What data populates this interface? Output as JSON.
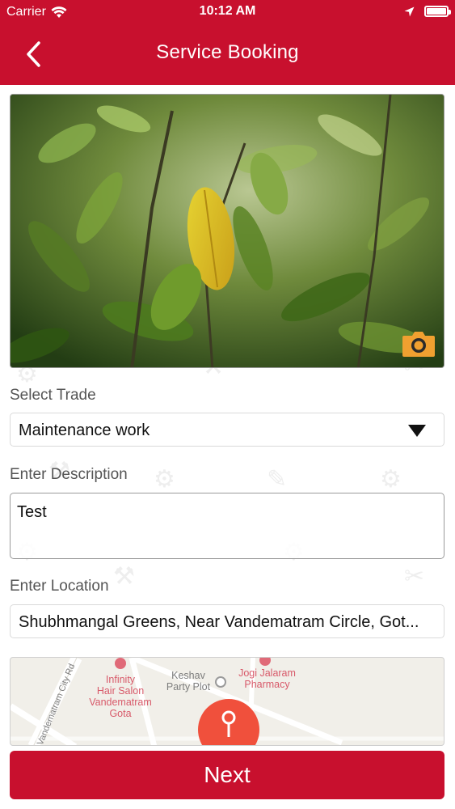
{
  "status_bar": {
    "carrier": "Carrier",
    "time": "10:12 AM",
    "icons": [
      "wifi-icon",
      "location-arrow-icon",
      "battery-icon"
    ]
  },
  "header": {
    "title": "Service Booking",
    "back_icon": "chevron-left-icon",
    "background_color": "#c8102e"
  },
  "photo": {
    "description_icon": "camera-icon",
    "camera_badge_color": "#f0a030"
  },
  "form": {
    "trade_label": "Select Trade",
    "trade_value": "Maintenance work",
    "description_label": "Enter Description",
    "description_value": "Test",
    "location_label": "Enter Location",
    "location_value": "Shubhmangal Greens, Near Vandematram Circle, Got..."
  },
  "map": {
    "road_label": "Vandematram City Rd",
    "places": [
      {
        "name_lines": [
          "Infinity",
          "Hair Salon",
          "Vandematram",
          "Gota"
        ],
        "style": "red"
      },
      {
        "name_lines": [
          "Keshav",
          "Party Plot"
        ],
        "style": "gray"
      },
      {
        "name_lines": [
          "Jogi Jalaram",
          "Pharmacy"
        ],
        "style": "red"
      }
    ],
    "pin_color": "#f0503c"
  },
  "footer": {
    "next_label": "Next",
    "button_color": "#c8102e"
  }
}
